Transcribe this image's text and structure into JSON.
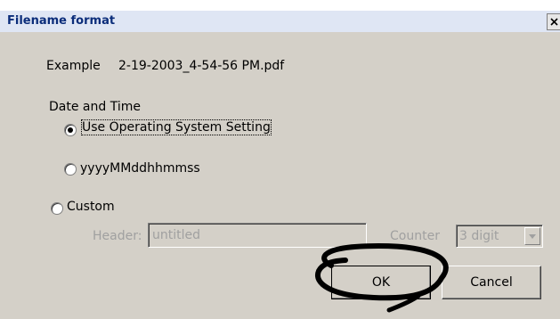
{
  "window": {
    "title": "Filename format",
    "close_glyph": "close-icon"
  },
  "example": {
    "label": "Example",
    "value": "2-19-2003_4-54-56 PM.pdf"
  },
  "date_time": {
    "group_label": "Date and Time",
    "options": [
      {
        "label": "Use Operating System Setting",
        "selected": true
      },
      {
        "label": "yyyyMMddhhmmss",
        "selected": false
      }
    ]
  },
  "custom": {
    "label": "Custom",
    "selected": false,
    "header_label": "Header:",
    "header_value": "untitled",
    "counter_label": "Counter",
    "counter_value": "3 digit"
  },
  "buttons": {
    "ok": "OK",
    "cancel": "Cancel"
  },
  "colors": {
    "dialog_bg": "#d4d0c8",
    "title_text": "#0b2d7a",
    "annotation": "#000000"
  }
}
